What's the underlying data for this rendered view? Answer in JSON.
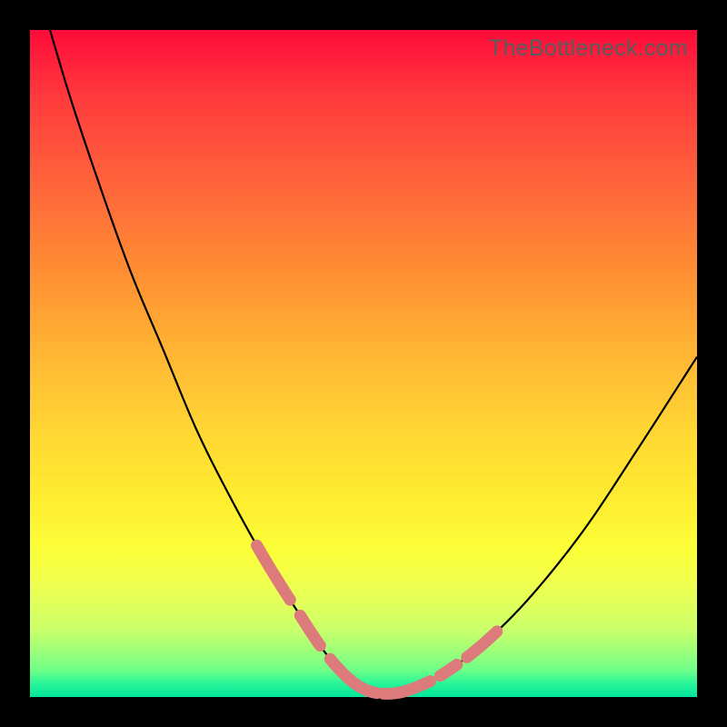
{
  "watermark": "TheBottleneck.com",
  "chart_data": {
    "type": "line",
    "title": "",
    "xlabel": "",
    "ylabel": "",
    "xlim": [
      0,
      100
    ],
    "ylim": [
      0,
      100
    ],
    "series": [
      {
        "name": "curve",
        "x": [
          3,
          6,
          10,
          15,
          20,
          25,
          30,
          35,
          40,
          44,
          47,
          49.5,
          52,
          55,
          58,
          62,
          68,
          75,
          83,
          91,
          100
        ],
        "y": [
          100,
          90,
          78,
          64,
          52,
          40,
          30,
          21,
          13,
          7,
          3.5,
          1.5,
          0.6,
          0.6,
          1.5,
          3.5,
          8,
          15,
          25,
          37,
          51
        ]
      }
    ],
    "markers": {
      "comment": "pink/salmon dashed segments overlaid on the curve near the valley",
      "color": "#dc7a7c",
      "regions_x": [
        [
          34,
          39
        ],
        [
          40.5,
          43.5
        ],
        [
          45,
          52
        ],
        [
          53,
          60
        ],
        [
          61.5,
          64
        ],
        [
          65.5,
          70
        ]
      ]
    },
    "colors": {
      "curve_stroke": "#000000",
      "marker_stroke": "#dc7a7c",
      "gradient_top": "#ff0b3a",
      "gradient_bottom": "#00e59c",
      "frame": "#000000"
    }
  }
}
